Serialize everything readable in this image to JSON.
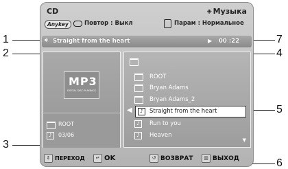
{
  "header": {
    "left_title": "CD",
    "right_title": "Музыка"
  },
  "subbar": {
    "anykey_badge": "Anykey",
    "repeat_text": "Повтор : Выкл",
    "param_text": "Парам : Нормальное"
  },
  "track": {
    "title": "Straight from the heart",
    "time": "00 :22"
  },
  "left_panel": {
    "logo_text": "MP3",
    "logo_subtext": "DIGITAL DISC PLAYBACK",
    "folder": "ROOT",
    "count": "03/06"
  },
  "file_list": [
    {
      "label": "ROOT",
      "type": "folder"
    },
    {
      "label": "Bryan Adams",
      "type": "folder"
    },
    {
      "label": "Bryan Adams_2",
      "type": "folder"
    },
    {
      "label": "Straight from the heart",
      "type": "track",
      "selected": true
    },
    {
      "label": "Run to you",
      "type": "track"
    },
    {
      "label": "Heaven",
      "type": "track"
    }
  ],
  "bottom": {
    "move": "ПЕРЕХОД",
    "ok": "OK",
    "return": "ВОЗВРАТ",
    "exit": "ВЫХОД"
  },
  "callouts": {
    "c1": "1",
    "c2": "2",
    "c3": "3",
    "c4": "4",
    "c5": "5",
    "c6": "6",
    "c7": "7"
  }
}
